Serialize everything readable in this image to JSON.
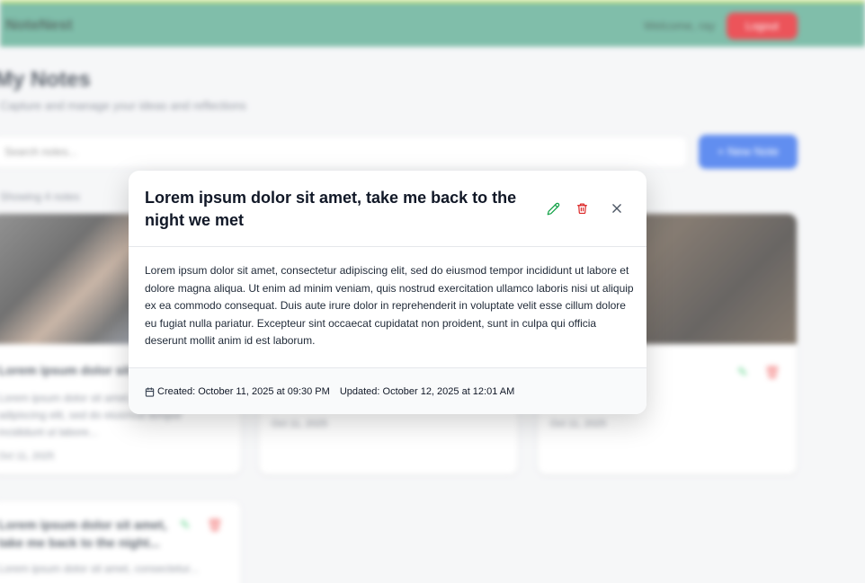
{
  "app": {
    "brand": "NoteNest",
    "welcome": "Welcome, ray",
    "logout_label": "Logout"
  },
  "page": {
    "title": "My Notes",
    "subtitle": "Capture and manage your ideas and reflections",
    "search_placeholder": "Search notes...",
    "new_note_label": "+ New Note",
    "count_text": "Showing 4 notes"
  },
  "cards": [
    {
      "title": "Lorem ipsum dolor sit",
      "text": "Lorem ipsum dolor sit amet, consectetur adipiscing elit, sed do eiusmod tempor incididunt ut labore...",
      "date": "Oct 11, 2025"
    },
    {
      "title": "",
      "text": "",
      "date": "Oct 11, 2025"
    },
    {
      "title": "",
      "text": "",
      "date": "Oct 11, 2025"
    },
    {
      "title": "Lorem ipsum dolor sit amet, take me back to the night...",
      "text": "Lorem ipsum dolor sit amet, consectetur...",
      "date": ""
    }
  ],
  "modal": {
    "title": "Lorem ipsum dolor sit amet, take me back to the night we met",
    "body": "Lorem ipsum dolor sit amet, consectetur adipiscing elit, sed do eiusmod tempor incididunt ut labore et dolore magna aliqua. Ut enim ad minim veniam, quis nostrud exercitation ullamco laboris nisi ut aliquip ex ea commodo consequat. Duis aute irure dolor in reprehenderit in voluptate velit esse cillum dolore eu fugiat nulla pariatur. Excepteur sint occaecat cupidatat non proident, sunt in culpa qui officia deserunt mollit anim id est laborum.",
    "created": "Created: October 11, 2025 at 09:30 PM",
    "updated": "Updated: October 12, 2025 at 12:01 AM",
    "icons": {
      "edit": "pencil-icon",
      "delete": "trash-icon",
      "close": "close-icon",
      "calendar": "calendar-icon"
    }
  },
  "colors": {
    "navbar": "#4fa58a",
    "logout": "#e5121b",
    "primary": "#2563eb",
    "edit": "#16a34a",
    "delete": "#dc2626"
  }
}
